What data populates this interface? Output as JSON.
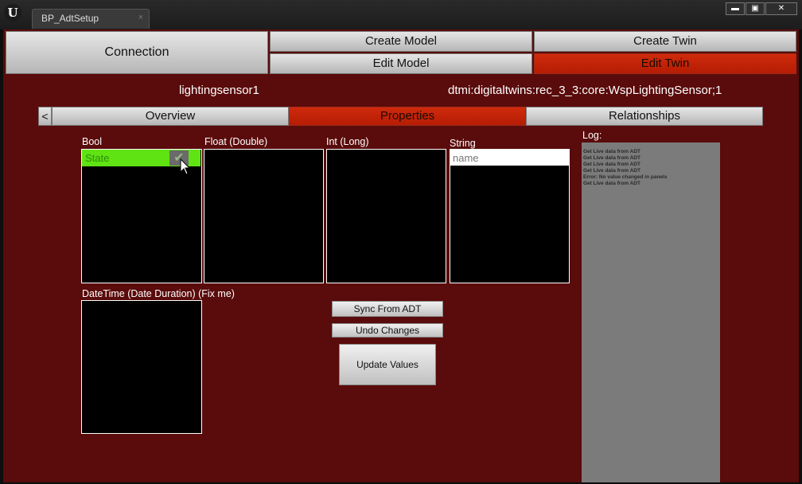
{
  "window": {
    "tab_title": "BP_AdtSetup",
    "tab_close": "×",
    "logo_glyph": "U",
    "controls": {
      "minimize": "▬",
      "maximize": "▣",
      "close": "✕"
    }
  },
  "nav": {
    "connection": "Connection",
    "create_model": "Create Model",
    "edit_model": "Edit Model",
    "create_twin": "Create Twin",
    "edit_twin": "Edit Twin",
    "active_item": "Edit Twin"
  },
  "twin": {
    "id": "lightingsensor1",
    "model_id": "dtmi:digitaltwins:rec_3_3:core:WspLightingSensor;1"
  },
  "tabs": {
    "back": "<",
    "overview": "Overview",
    "properties": "Properties",
    "relationships": "Relationships",
    "active": "Properties"
  },
  "panels": {
    "bool": {
      "label": "Bool",
      "items": [
        {
          "name": "State",
          "checked": true
        }
      ]
    },
    "float": {
      "label": "Float (Double)"
    },
    "int": {
      "label": "Int (Long)"
    },
    "string": {
      "label": "String",
      "input_placeholder": "name"
    },
    "datetime": {
      "label": "DateTime (Date Duration) (Fix me)"
    }
  },
  "actions": {
    "sync": "Sync From ADT",
    "undo": "Undo Changes",
    "update": "Update Values"
  },
  "log": {
    "label": "Log:",
    "lines": [
      "Get Live data from ADT",
      "Get Live data from ADT",
      "Get Live data from ADT",
      "Get Live data from ADT",
      "Error: No value changed in panels",
      "Get Live data from ADT"
    ]
  },
  "colors": {
    "background": "#5a0b0b",
    "active": "#c4240a",
    "bool_row": "#5fe312",
    "log_bg": "#7b7b7b"
  }
}
